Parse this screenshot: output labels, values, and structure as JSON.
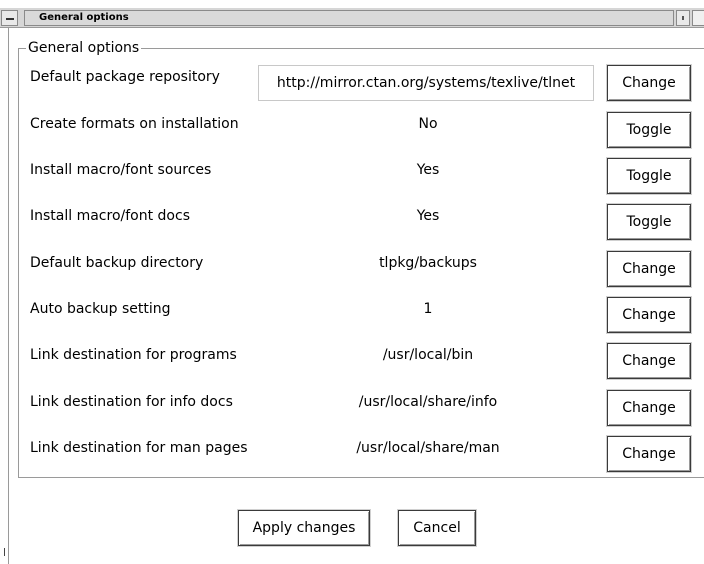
{
  "window": {
    "title": "General options"
  },
  "group_title": "General options",
  "rows": [
    {
      "label": "Default package repository",
      "value": "http://mirror.ctan.org/systems/texlive/tlnet",
      "button": "Change"
    },
    {
      "label": "Create formats on installation",
      "value": "No",
      "button": "Toggle"
    },
    {
      "label": "Install macro/font sources",
      "value": "Yes",
      "button": "Toggle"
    },
    {
      "label": "Install macro/font docs",
      "value": "Yes",
      "button": "Toggle"
    },
    {
      "label": "Default backup directory",
      "value": "tlpkg/backups",
      "button": "Change"
    },
    {
      "label": "Auto backup setting",
      "value": "1",
      "button": "Change"
    },
    {
      "label": "Link destination for programs",
      "value": "/usr/local/bin",
      "button": "Change"
    },
    {
      "label": "Link destination for info docs",
      "value": "/usr/local/share/info",
      "button": "Change"
    },
    {
      "label": "Link destination for man pages",
      "value": "/usr/local/share/man",
      "button": "Change"
    }
  ],
  "footer": {
    "apply_label": "Apply changes",
    "cancel_label": "Cancel"
  },
  "icons": {
    "window_menu": "window-menu-icon",
    "maximize": "maximize-icon"
  }
}
